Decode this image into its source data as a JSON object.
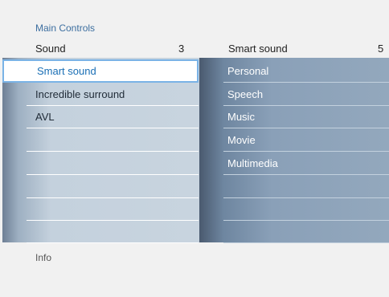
{
  "breadcrumb": "Main Controls",
  "left_header": {
    "label": "Sound",
    "count": "3"
  },
  "right_header": {
    "label": "Smart sound",
    "count": "5"
  },
  "left_items": [
    "Smart sound",
    "Incredible surround",
    "AVL",
    "",
    "",
    "",
    "",
    ""
  ],
  "right_items": [
    "Personal",
    "Speech",
    "Music",
    "Movie",
    "Multimedia",
    "",
    "",
    ""
  ],
  "info": "Info",
  "colors": {
    "selection_text": "#1a6fb5",
    "selection_border": "#7ab3e6",
    "breadcrumb": "#3d6fa0"
  }
}
